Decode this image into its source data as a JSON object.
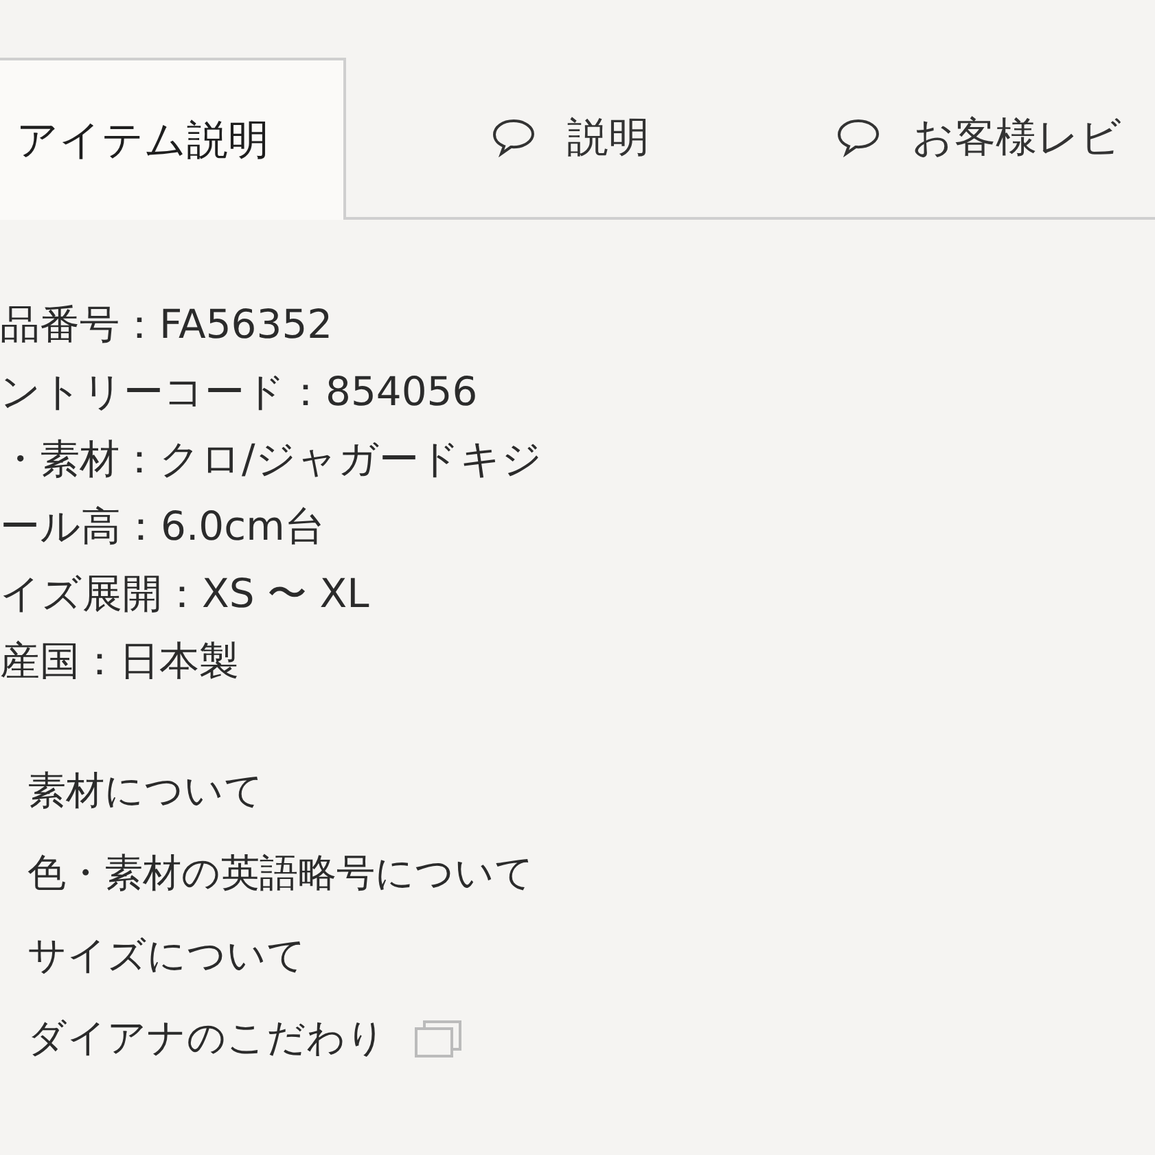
{
  "tabs": [
    {
      "label": "アイテム説明",
      "selected": true,
      "comment_icon": false
    },
    {
      "label": "説明",
      "selected": false,
      "comment_icon": true
    },
    {
      "label": "お客様レビ",
      "selected": false,
      "comment_icon": true
    }
  ],
  "specs": [
    "品番号：FA56352",
    "ントリーコード：854056",
    "・素材：クロ/ジャガードキジ",
    "ール高：6.0cm台",
    "イズ展開：XS 〜 XL",
    "産国：日本製"
  ],
  "links": [
    {
      "label": "素材について",
      "external": false
    },
    {
      "label": "色・素材の英語略号について",
      "external": false
    },
    {
      "label": "サイズについて",
      "external": false
    },
    {
      "label": "ダイアナのこだわり",
      "external": true
    }
  ]
}
